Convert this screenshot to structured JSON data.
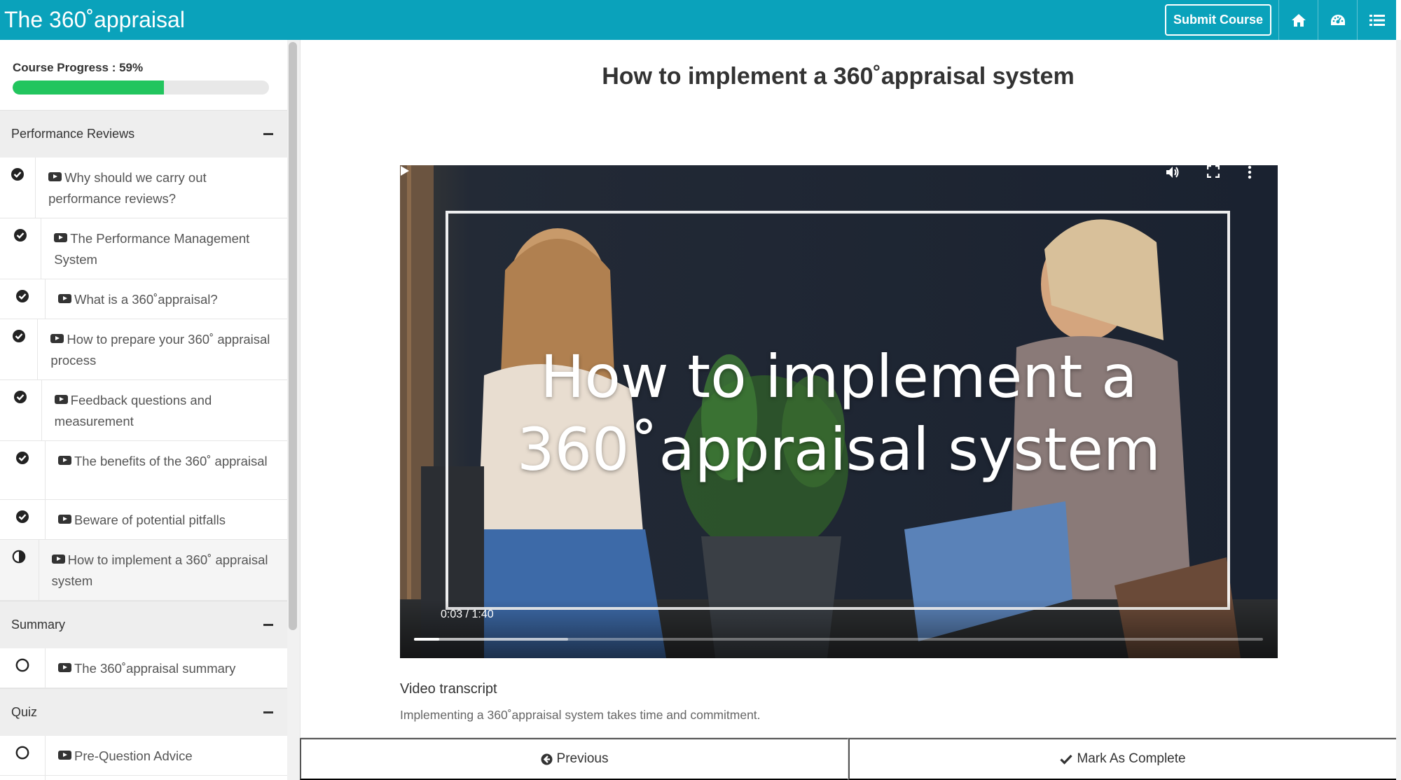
{
  "header": {
    "title": "The 360˚appraisal",
    "submit_label": "Submit Course",
    "icons": [
      "home-icon",
      "dashboard-icon",
      "list-icon"
    ],
    "brand_color": "#0aa2bb"
  },
  "sidebar": {
    "progress_label": "Course Progress : 59%",
    "progress_value": 0.59,
    "progress_color": "#22c55e",
    "sections": [
      {
        "title": "Performance Reviews",
        "lessons": [
          {
            "label": "Why should we carry out performance reviews?",
            "status": "complete"
          },
          {
            "label": "The Performance Management System",
            "status": "complete"
          },
          {
            "label": "What is a 360˚appraisal?",
            "status": "complete"
          },
          {
            "label": "How to prepare your 360˚ appraisal process",
            "status": "complete"
          },
          {
            "label": "Feedback questions and measurement",
            "status": "complete"
          },
          {
            "label": "The benefits of the 360˚ appraisal",
            "status": "complete"
          },
          {
            "label": "Beware of potential pitfalls",
            "status": "complete"
          },
          {
            "label": "How to implement a 360˚ appraisal system",
            "status": "in-progress"
          }
        ]
      },
      {
        "title": "Summary",
        "lessons": [
          {
            "label": "The 360˚appraisal summary",
            "status": "not-started"
          }
        ]
      },
      {
        "title": "Quiz",
        "lessons": [
          {
            "label": "Pre-Question Advice",
            "status": "not-started"
          }
        ]
      }
    ]
  },
  "main": {
    "title": "How to implement a 360˚appraisal system",
    "video": {
      "overlay_line1": "How to implement a",
      "overlay_line2": "360˚appraisal system",
      "time": "0:03 / 1:40",
      "played_fraction": 0.03
    },
    "transcript_heading": "Video transcript",
    "transcript_text": "Implementing a 360˚appraisal system takes time and commitment."
  },
  "footer": {
    "previous_label": "Previous",
    "complete_label": "Mark As Complete"
  }
}
